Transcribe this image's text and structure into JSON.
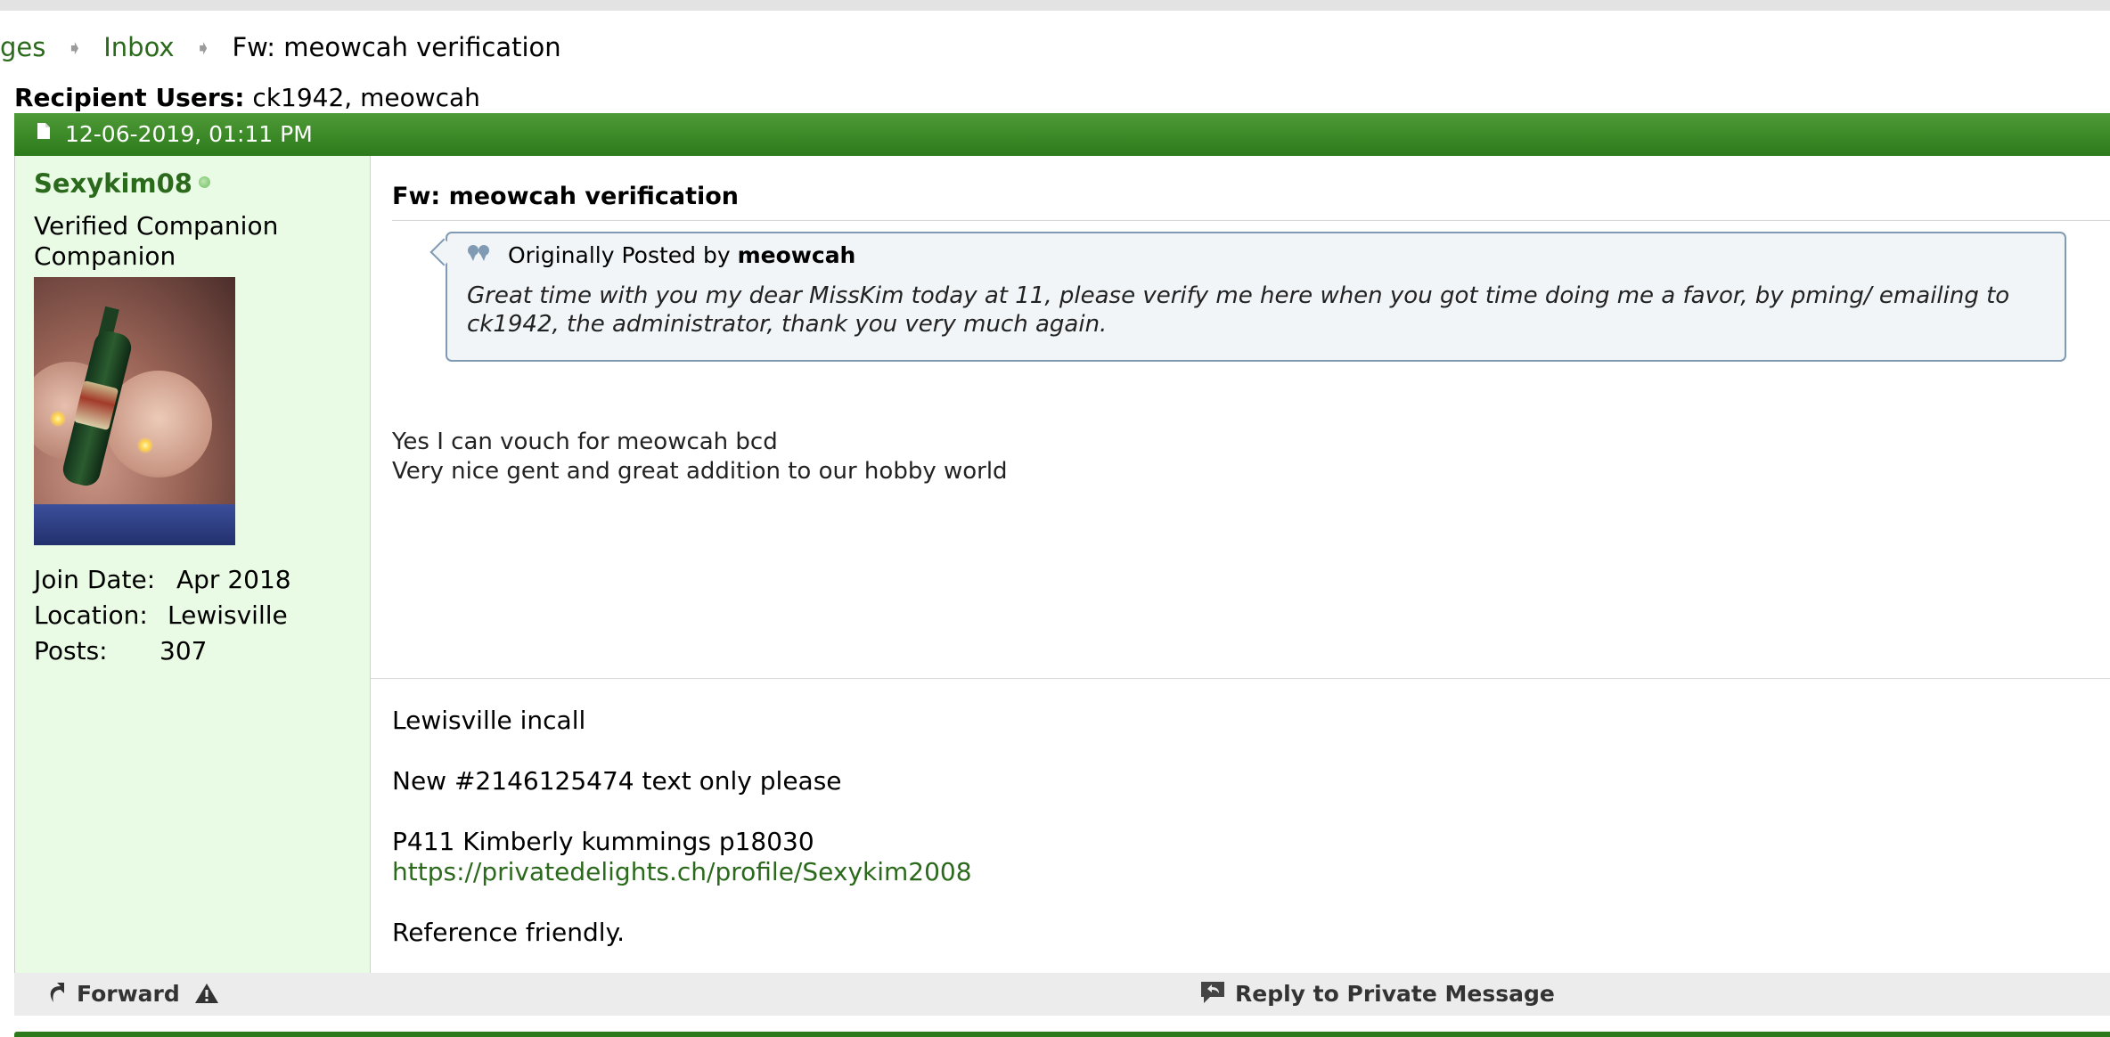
{
  "breadcrumb": {
    "parent": "ges",
    "inbox": "Inbox",
    "current": "Fw: meowcah verification"
  },
  "recipients": {
    "label": "Recipient Users:",
    "value": "ck1942, meowcah"
  },
  "post": {
    "date": "12-06-2019, 01:11 PM",
    "user": {
      "name": "Sexykim08",
      "title": "Verified Companion",
      "rank": "Companion",
      "join_date_label": "Join Date:",
      "join_date": "Apr 2018",
      "location_label": "Location:",
      "location": "Lewisville",
      "posts_label": "Posts:",
      "posts": "307"
    },
    "title": "Fw: meowcah verification",
    "quote": {
      "prefix": "Originally Posted by",
      "author": "meowcah",
      "text": "Great time with you my dear MissKim today at 11, please verify me here when you got time doing me a favor, by pming/ emailing to ck1942, the administrator, thank you very much again."
    },
    "message_line1": "Yes I can vouch for meowcah bcd",
    "message_line2": "Very nice gent and great addition to our hobby world",
    "signature": {
      "line1": "Lewisville incall",
      "line2": "New #2146125474 text only please",
      "line3": "P411 Kimberly kummings p18030",
      "link": "https://privatedelights.ch/profile/Sexykim2008",
      "line4": "Reference friendly."
    }
  },
  "footer": {
    "forward_label": "Forward",
    "reply_label": "Reply to Private Message"
  },
  "colors": {
    "header_green": "#3f8c2a",
    "link_green": "#2b6a1c",
    "userinfo_bg": "#eafbe5",
    "quote_bg": "#f1f5f8",
    "quote_border": "#7f9ab2"
  },
  "icons": [
    "bullet-arrow-icon",
    "document-icon",
    "online-status-icon",
    "quote-icon",
    "forward-icon",
    "warning-icon",
    "reply-icon"
  ]
}
